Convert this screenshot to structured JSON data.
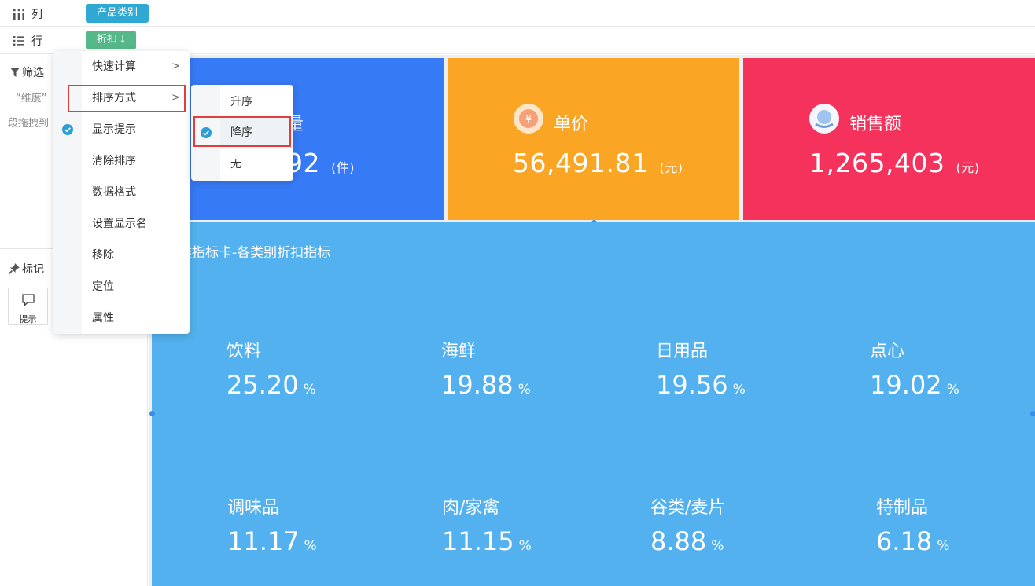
{
  "shelf": {
    "columns_label": "列",
    "rows_label": "行",
    "column_pill": "产品类别",
    "row_pill": "折扣 ⭣"
  },
  "left_panel": {
    "filter_title": "筛选",
    "filter_hint_1": "“维度”",
    "filter_hint_2": "段拖拽到",
    "mark_title": "标记",
    "tip_label": "提示"
  },
  "cards": {
    "quantity": {
      "title_fragment": "量",
      "value_fragment": "92",
      "unit": "(件)"
    },
    "price": {
      "title": "单价",
      "value": "56,491.81",
      "unit": "(元)",
      "icon_glyph": "¥"
    },
    "sales": {
      "title": "销售额",
      "value": "1,265,403",
      "unit": "(元)"
    }
  },
  "big_card": {
    "title": "类指标卡-各类别折扣指标",
    "metrics": [
      {
        "name": "饮料",
        "value": "25.20",
        "pct": "%"
      },
      {
        "name": "海鲜",
        "value": "19.88",
        "pct": "%"
      },
      {
        "name": "日用品",
        "value": "19.56",
        "pct": "%"
      },
      {
        "name": "点心",
        "value": "19.02",
        "pct": "%"
      },
      {
        "name": "调味品",
        "value": "11.17",
        "pct": "%"
      },
      {
        "name": "肉/家禽",
        "value": "11.15",
        "pct": "%"
      },
      {
        "name": "谷类/麦片",
        "value": "8.88",
        "pct": "%"
      },
      {
        "name": "特制品",
        "value": "6.18",
        "pct": "%"
      }
    ]
  },
  "context_menu": {
    "items": [
      {
        "label": "快速计算",
        "submenu": true
      },
      {
        "label": "排序方式",
        "submenu": true
      },
      {
        "label": "显示提示",
        "checked": true
      },
      {
        "label": "清除排序"
      },
      {
        "label": "数据格式"
      },
      {
        "label": "设置显示名"
      },
      {
        "label": "移除"
      },
      {
        "label": "定位"
      },
      {
        "label": "属性"
      }
    ]
  },
  "sort_submenu": {
    "items": [
      {
        "label": "升序"
      },
      {
        "label": "降序",
        "checked": true
      },
      {
        "label": "无"
      }
    ]
  },
  "colors": {
    "quantity_card": "#377af5",
    "price_card": "#fba524",
    "sales_card": "#f5325c",
    "metric_card": "#52b1ee",
    "highlight_outline": "#e0403c",
    "check": "#2d9fd8"
  }
}
